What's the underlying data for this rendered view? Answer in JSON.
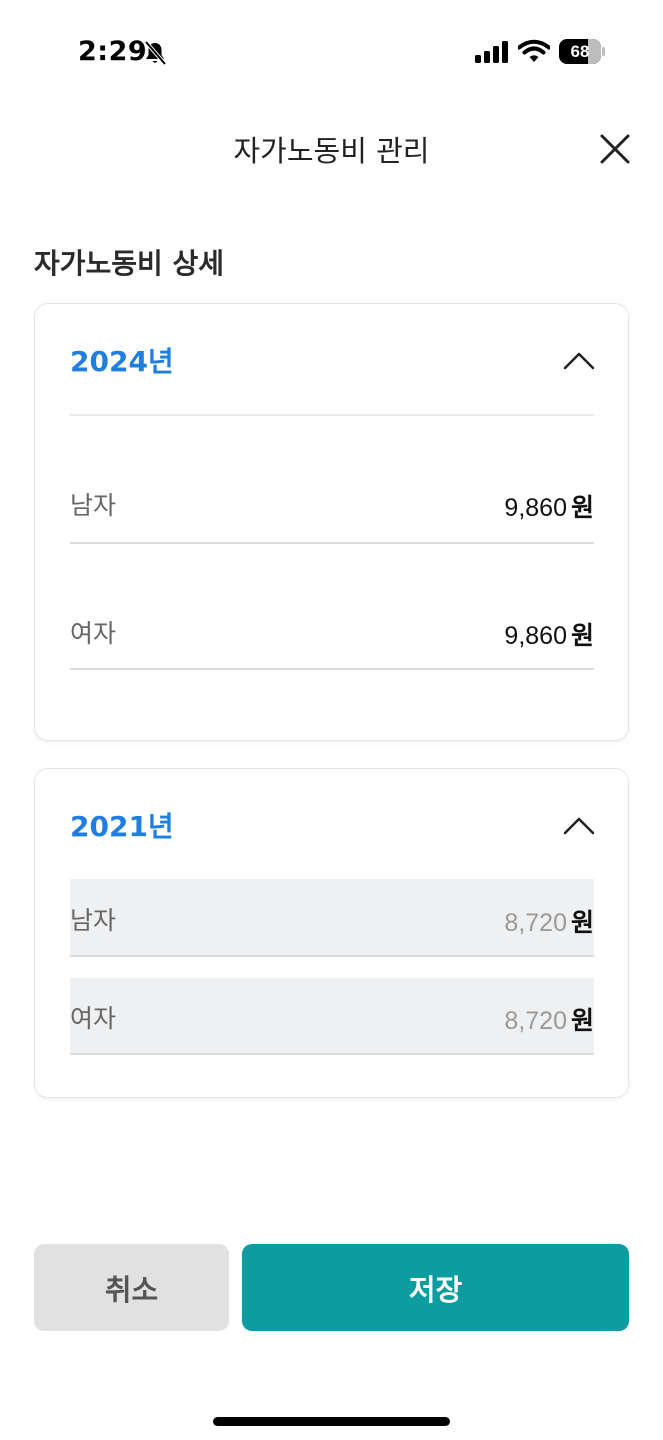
{
  "status_bar": {
    "time": "2:29",
    "battery_text": "68",
    "battery_level": 0.68
  },
  "header": {
    "title": "자가노동비 관리"
  },
  "section": {
    "title": "자가노동비 상세"
  },
  "cards": [
    {
      "year": "2024년",
      "expanded": true,
      "editable": true,
      "rows": [
        {
          "label": "남자",
          "value": "9,860",
          "unit": "원"
        },
        {
          "label": "여자",
          "value": "9,860",
          "unit": "원"
        }
      ]
    },
    {
      "year": "2021년",
      "expanded": true,
      "editable": false,
      "rows": [
        {
          "label": "남자",
          "value": "8,720",
          "unit": "원"
        },
        {
          "label": "여자",
          "value": "8,720",
          "unit": "원"
        }
      ]
    }
  ],
  "buttons": {
    "cancel": "취소",
    "save": "저장"
  },
  "colors": {
    "accent_blue": "#1f7ee0",
    "primary_teal": "#0d9c9f",
    "cancel_gray": "#e1e1e1",
    "disabled_row_bg": "#eef0f2"
  }
}
